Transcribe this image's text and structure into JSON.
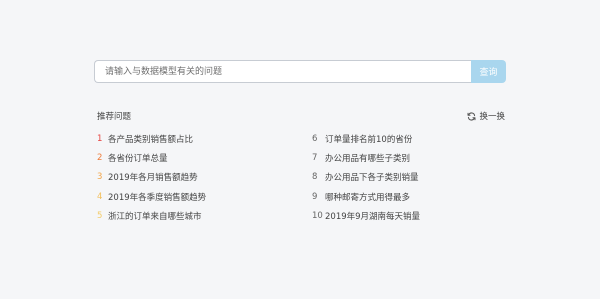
{
  "search": {
    "placeholder": "请输入与数据模型有关的问题",
    "button_label": "查询"
  },
  "suggestions": {
    "title": "推荐问题",
    "refresh_label": "换一换",
    "left": [
      {
        "num": "1",
        "text": "各产品类别销售额占比",
        "color": "#e64340"
      },
      {
        "num": "2",
        "text": "各省份订单总量",
        "color": "#ef7c3b"
      },
      {
        "num": "3",
        "text": "2019年各月销售额趋势",
        "color": "#f2a64a"
      },
      {
        "num": "4",
        "text": "2019年各季度销售额趋势",
        "color": "#f2bd58"
      },
      {
        "num": "5",
        "text": "浙江的订单来自哪些城市",
        "color": "#f4cc6a"
      }
    ],
    "right": [
      {
        "num": "6",
        "text": "订单量排名前10的省份",
        "color": "#666666"
      },
      {
        "num": "7",
        "text": "办公用品有哪些子类别",
        "color": "#666666"
      },
      {
        "num": "8",
        "text": "办公用品下各子类别销量",
        "color": "#666666"
      },
      {
        "num": "9",
        "text": "哪种邮寄方式用得最多",
        "color": "#666666"
      },
      {
        "num": "10",
        "text": "2019年9月湖南每天销量",
        "color": "#666666"
      }
    ]
  },
  "icons": {
    "refresh": "refresh-icon"
  },
  "colors": {
    "background": "#f5f6f8",
    "button": "#a9d6ee"
  }
}
